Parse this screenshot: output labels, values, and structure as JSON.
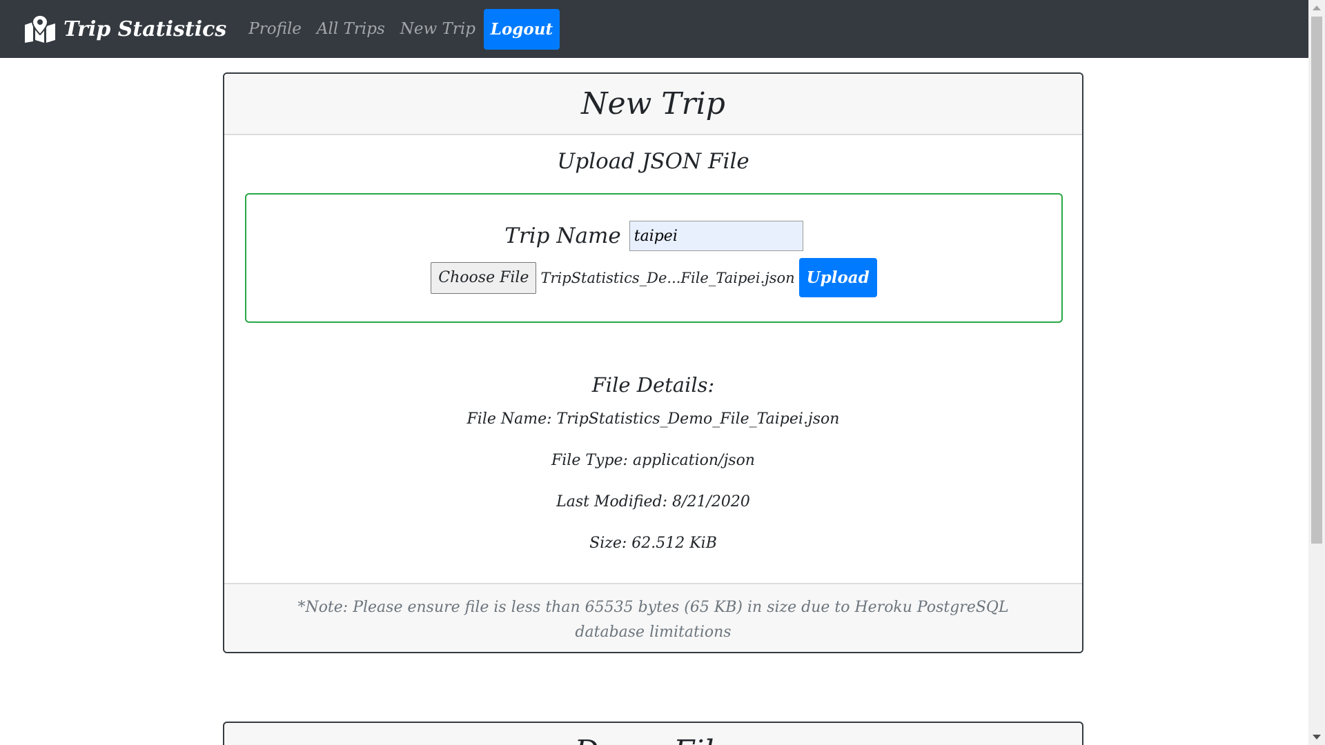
{
  "navbar": {
    "brand": "Trip Statistics",
    "links": [
      "Profile",
      "All Trips",
      "New Trip"
    ],
    "logout": "Logout"
  },
  "card": {
    "title": "New Trip",
    "upload_heading": "Upload JSON File",
    "trip_name_label": "Trip Name",
    "trip_name_value": "taipei",
    "choose_file_label": "Choose File",
    "chosen_file": "TripStatistics_De...File_Taipei.json",
    "upload_label": "Upload",
    "details_heading": "File Details:",
    "details": [
      "File Name: TripStatistics_Demo_File_Taipei.json",
      "File Type: application/json",
      "Last Modified: 8/21/2020",
      "Size: 62.512 KiB"
    ],
    "note": "*Note: Please ensure file is less than 65535 bytes (65 KB) in size due to Heroku PostgreSQL database limitations"
  },
  "next_card": {
    "title": "Demo File"
  },
  "colors": {
    "navbar_bg": "#343a40",
    "primary": "#007bff",
    "success_border": "#28a745",
    "muted": "#6c757d"
  }
}
